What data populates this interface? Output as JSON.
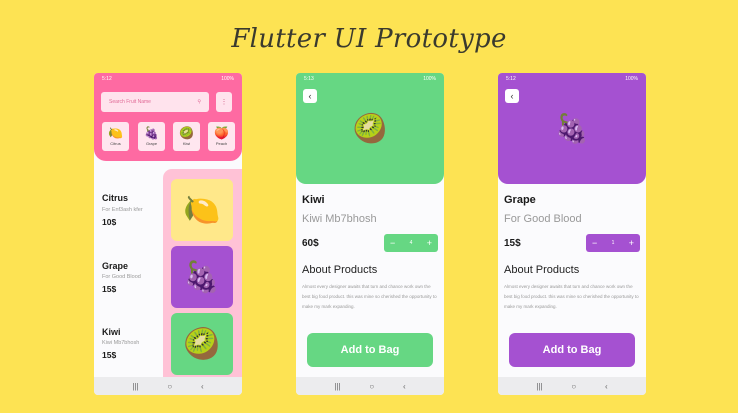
{
  "title": "Flutter UI Prototype",
  "colors": {
    "background": "#fde353",
    "pink": "#fe6aa2",
    "green": "#66d783",
    "purple": "#a551d1"
  },
  "status": {
    "p1_time": "5:12",
    "p2_time": "5:13",
    "p3_time": "5:12",
    "battery": "100%"
  },
  "home": {
    "search_placeholder": "Search Fruit Name",
    "categories": [
      {
        "emoji": "🍋",
        "label": "Citrus"
      },
      {
        "emoji": "🍇",
        "label": "Grape"
      },
      {
        "emoji": "🥝",
        "label": "Kiwi"
      },
      {
        "emoji": "🍑",
        "label": "Peach"
      }
    ],
    "products": [
      {
        "name": "Citrus",
        "subtitle": "For Enf3ash kfer",
        "price": "10$",
        "emoji": "🍋"
      },
      {
        "name": "Grape",
        "subtitle": "For Good Blood",
        "price": "15$",
        "emoji": "🍇"
      },
      {
        "name": "Kiwi",
        "subtitle": "Kiwi Mb7bhosh",
        "price": "15$",
        "emoji": "🥝"
      }
    ]
  },
  "kiwi_detail": {
    "emoji": "🥝",
    "name": "Kiwi",
    "subtitle": "Kiwi Mb7bhosh",
    "price": "60$",
    "quantity": "4",
    "about_heading": "About Products",
    "about_text": "Almost every designer awaits that turn and chance work own the best big food product. this was mine so cherished the opportunity to make my mark expanding.",
    "cta": "Add to Bag"
  },
  "grape_detail": {
    "emoji": "🍇",
    "name": "Grape",
    "subtitle": "For Good Blood",
    "price": "15$",
    "quantity": "1",
    "about_heading": "About Products",
    "about_text": "Almost every designer awaits that turn and chance work own the best big food product. this was mine so cherished the opportunity to make my mark expanding.",
    "cta": "Add to Bag"
  },
  "nav": {
    "recents": "|||",
    "home": "○",
    "back": "‹"
  },
  "glyphs": {
    "search": "⚲",
    "menu": "⋮",
    "back": "‹",
    "minus": "−",
    "plus": "+"
  }
}
